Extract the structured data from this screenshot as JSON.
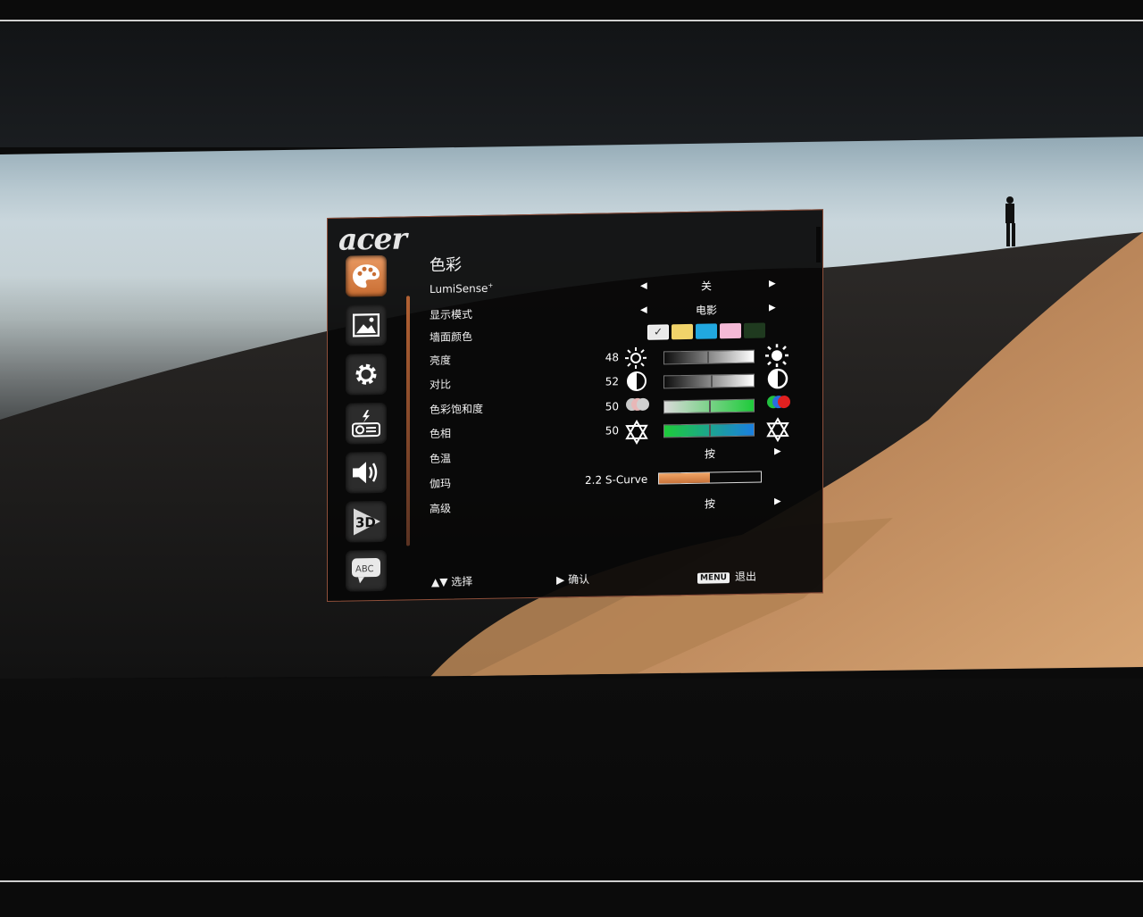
{
  "osd": {
    "logo": "acer",
    "title": "色彩",
    "sidebar": [
      {
        "name": "palette-icon"
      },
      {
        "name": "image-icon"
      },
      {
        "name": "gear-icon"
      },
      {
        "name": "projector-icon"
      },
      {
        "name": "speaker-icon"
      },
      {
        "name": "3d-icon",
        "text": "3D"
      },
      {
        "name": "language-abc-icon",
        "text": "ABC"
      }
    ],
    "lumisense": {
      "label": "LumiSense",
      "sup": "+",
      "value": "关"
    },
    "display_mode": {
      "label": "显示模式",
      "value": "电影"
    },
    "wall_color": {
      "label": "墙面颜色",
      "swatches": [
        "#e9e9e9",
        "#f0d36a",
        "#21a8e0",
        "#f4b9d6",
        "#1f3a1f"
      ],
      "selected_index": 0
    },
    "brightness": {
      "label": "亮度",
      "value": "48"
    },
    "contrast": {
      "label": "对比",
      "value": "52"
    },
    "saturation": {
      "label": "色彩饱和度",
      "value": "50"
    },
    "hue": {
      "label": "色相",
      "value": "50"
    },
    "color_temp": {
      "label": "色温",
      "value": "按"
    },
    "gamma": {
      "label": "伽玛",
      "value": "2.2 S-Curve",
      "level": 0.5
    },
    "advanced": {
      "label": "高级",
      "value": "按"
    },
    "footer": {
      "select": "选择",
      "confirm": "确认",
      "menu_badge": "MENU",
      "exit": "退出"
    }
  }
}
